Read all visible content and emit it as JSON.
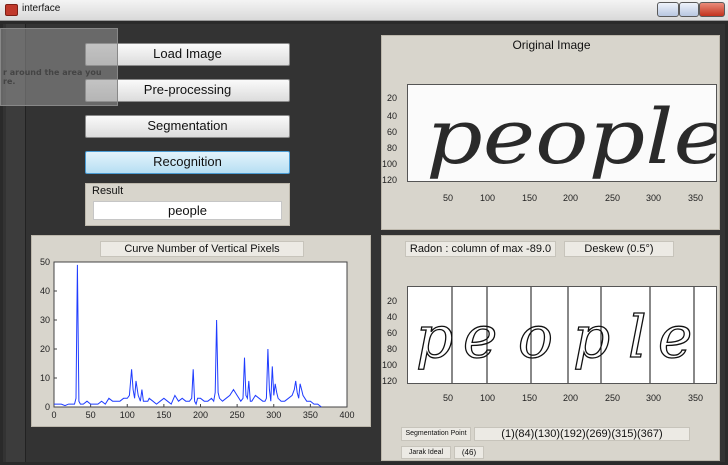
{
  "window": {
    "title": "interface"
  },
  "tooltip": {
    "line1": "r around the area you",
    "line2": "re."
  },
  "buttons": {
    "load": "Load Image",
    "preprocess": "Pre-processing",
    "segmentation": "Segmentation",
    "recognition": "Recognition"
  },
  "result": {
    "label": "Result",
    "value": "people"
  },
  "original": {
    "title": "Original Image",
    "yticks": [
      "20",
      "40",
      "60",
      "80",
      "100",
      "120"
    ],
    "xticks": [
      "50",
      "100",
      "150",
      "200",
      "250",
      "300",
      "350"
    ],
    "word": "people"
  },
  "curve": {
    "title": "Curve Number of Vertical Pixels",
    "chart_data": {
      "type": "line",
      "title": "Curve Number of Vertical Pixels",
      "xlim": [
        0,
        400
      ],
      "ylim": [
        0,
        50
      ],
      "xticks": [
        0,
        50,
        100,
        150,
        200,
        250,
        300,
        350,
        400
      ],
      "yticks": [
        0,
        10,
        20,
        30,
        40,
        50
      ],
      "series": [
        {
          "color": "#1f3cff",
          "x": [
            0,
            5,
            10,
            15,
            20,
            25,
            28,
            30,
            32,
            34,
            36,
            38,
            40,
            45,
            50,
            55,
            60,
            65,
            70,
            75,
            80,
            85,
            90,
            95,
            100,
            103,
            106,
            108,
            110,
            112,
            115,
            118,
            120,
            122,
            125,
            128,
            130,
            135,
            140,
            145,
            150,
            155,
            160,
            165,
            170,
            175,
            180,
            185,
            188,
            190,
            192,
            194,
            196,
            200,
            205,
            210,
            215,
            218,
            220,
            222,
            224,
            226,
            230,
            235,
            240,
            245,
            250,
            255,
            258,
            260,
            262,
            264,
            266,
            268,
            270,
            275,
            280,
            285,
            288,
            290,
            292,
            294,
            296,
            298,
            300,
            302,
            304,
            306,
            310,
            315,
            320,
            325,
            328,
            330,
            332,
            334,
            336,
            338,
            340,
            345,
            350,
            355,
            360,
            365
          ],
          "y": [
            1,
            1,
            1,
            0.5,
            1,
            1,
            1,
            3,
            49,
            2,
            1,
            1,
            1,
            2,
            1,
            1,
            1,
            2,
            1,
            3,
            2,
            2,
            2,
            3,
            3,
            4,
            13,
            6,
            3,
            9,
            4,
            2,
            6,
            2,
            2,
            2,
            3,
            2,
            1,
            2,
            3,
            2,
            1,
            4,
            2,
            3,
            2,
            2,
            3,
            13,
            2,
            1,
            3,
            3,
            2,
            2,
            3,
            2,
            5,
            30,
            5,
            3,
            2,
            3,
            4,
            6,
            4,
            2,
            3,
            17,
            4,
            3,
            9,
            2,
            2,
            4,
            3,
            2,
            2,
            3,
            20,
            6,
            2,
            14,
            4,
            8,
            5,
            3,
            2,
            2,
            3,
            4,
            6,
            9,
            5,
            3,
            8,
            6,
            4,
            2,
            2,
            1,
            1,
            0
          ]
        }
      ]
    }
  },
  "radon": {
    "text": "Radon : column of max -89.0"
  },
  "deskew": {
    "text": "Deskew (0.5°)"
  },
  "segmented": {
    "yticks": [
      "20",
      "40",
      "60",
      "80",
      "100",
      "120"
    ],
    "xticks": [
      "50",
      "100",
      "150",
      "200",
      "250",
      "300",
      "350"
    ],
    "letters": [
      "p",
      "e",
      "o",
      "p",
      "l",
      "e"
    ]
  },
  "segmentation_point": {
    "label": "Segmentation Point",
    "value": "(1)(84)(130)(192)(269)(315)(367)"
  },
  "jarak_ideal": {
    "label": "Jarak Ideal",
    "value": "(46)"
  },
  "colors": {
    "accent": "#4b9cd3",
    "panel": "#d8d5cc",
    "line": "#1f3cff"
  }
}
